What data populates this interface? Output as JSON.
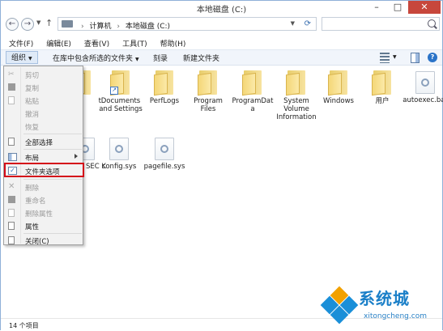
{
  "window": {
    "title": "本地磁盘 (C:)",
    "minimize": "–",
    "maximize": "□",
    "close": "✕"
  },
  "address": {
    "back": "←",
    "forward": "→",
    "up": "↑",
    "crumbs": [
      "计算机",
      "本地磁盘 (C:)"
    ],
    "separator": "›"
  },
  "menu": [
    "文件(F)",
    "编辑(E)",
    "查看(V)",
    "工具(T)",
    "帮助(H)"
  ],
  "toolbar": {
    "organize": "组织",
    "include_library": "在库中包含所选的文件夹",
    "burn": "刻录",
    "new_folder": "新建文件夹"
  },
  "items": [
    {
      "type": "folder",
      "label": "t",
      "icon": "folder-icon"
    },
    {
      "type": "folder",
      "label": "Documents and Settings",
      "icon": "folder-shortcut-icon"
    },
    {
      "type": "folder",
      "label": "PerfLogs",
      "icon": "folder-icon"
    },
    {
      "type": "folder",
      "label": "Program Files",
      "icon": "folder-icon"
    },
    {
      "type": "folder",
      "label": "ProgramData",
      "icon": "folder-icon"
    },
    {
      "type": "folder",
      "label": "System Volume Information",
      "icon": "folder-icon"
    },
    {
      "type": "folder",
      "label": "Windows",
      "icon": "folder-icon"
    },
    {
      "type": "folder",
      "label": "用户",
      "icon": "folder-icon"
    },
    {
      "type": "file",
      "label": "autoexec.bat",
      "icon": "system-file-icon"
    },
    {
      "type": "file",
      "label": "SEC K",
      "icon": "system-file-icon"
    },
    {
      "type": "file",
      "label": "config.sys",
      "icon": "system-file-icon"
    },
    {
      "type": "file",
      "label": "pagefile.sys",
      "icon": "system-file-icon"
    }
  ],
  "context_menu": [
    {
      "label": "剪切",
      "disabled": true
    },
    {
      "label": "复制",
      "disabled": true
    },
    {
      "label": "粘贴",
      "disabled": true
    },
    {
      "label": "撤消",
      "disabled": true
    },
    {
      "label": "恢复",
      "disabled": true
    },
    {
      "label": "全部选择",
      "disabled": false
    },
    {
      "label": "布局",
      "disabled": false,
      "submenu": true
    },
    {
      "label": "文件夹选项",
      "disabled": false,
      "highlighted": true
    },
    {
      "label": "删除",
      "disabled": true
    },
    {
      "label": "重命名",
      "disabled": true
    },
    {
      "label": "删除属性",
      "disabled": true
    },
    {
      "label": "属性",
      "disabled": false
    },
    {
      "label": "关闭(C)",
      "disabled": false
    }
  ],
  "status": "14 个项目",
  "watermark": {
    "name": "系统城",
    "url": "xitongcheng.com"
  },
  "colors": {
    "highlight": "#d40b19",
    "toolbar": "#f1f5fb",
    "close": "#c7473c",
    "watermark": "#1a7fc8"
  }
}
